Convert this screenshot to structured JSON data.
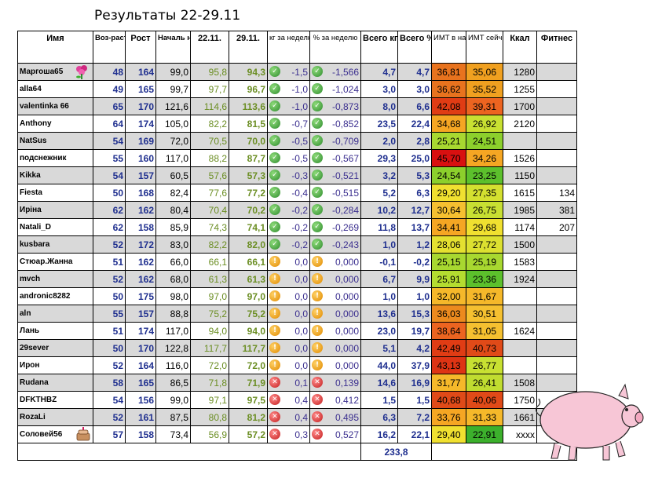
{
  "title": "Результаты  22-29.11",
  "headers": {
    "name": "Имя",
    "age": "Воз-раст",
    "height": "Рост",
    "start": "Началь ный вес",
    "w1": "22.11.",
    "w2": "29.11.",
    "dkg": "кг за неделю",
    "dpct": "% за неделю",
    "tkg": "Всего кг",
    "tpct": "Всего %",
    "bmi_start": "ИМТ в начале",
    "bmi_now": "ИМТ сейчас",
    "kcal": "Ккал",
    "fitness": "Фитнес"
  },
  "colors": {
    "ok": "#2e8b2e",
    "flat": "#e08a00",
    "bad": "#c41e1e",
    "shade": "#d9d9d9"
  },
  "rows": [
    {
      "name": "Маргоша65",
      "age": "48",
      "height": "164",
      "start": "99,0",
      "w1": "95,8",
      "w2": "94,3",
      "status": "ok",
      "dkg": "-1,5",
      "dpct": "-1,566",
      "tkg": "4,7",
      "tpct": "4,7",
      "b1": "36,81",
      "b1c": "#e8731e",
      "b2": "35,06",
      "b2c": "#f0a020",
      "kcal": "1280",
      "fit": "",
      "shade": true,
      "icon": "flower-icon"
    },
    {
      "name": "alla64",
      "age": "49",
      "height": "165",
      "start": "99,7",
      "w1": "97,7",
      "w2": "96,7",
      "status": "ok",
      "dkg": "-1,0",
      "dpct": "-1,024",
      "tkg": "3,0",
      "tpct": "3,0",
      "b1": "36,62",
      "b1c": "#e8731e",
      "b2": "35,52",
      "b2c": "#f0a020",
      "kcal": "1255",
      "fit": "",
      "shade": false
    },
    {
      "name": "valentinka 66",
      "age": "65",
      "height": "170",
      "start": "121,6",
      "w1": "114,6",
      "w2": "113,6",
      "status": "ok",
      "dkg": "-1,0",
      "dpct": "-0,873",
      "tkg": "8,0",
      "tpct": "6,6",
      "b1": "42,08",
      "b1c": "#e03c14",
      "b2": "39,31",
      "b2c": "#ec6420",
      "kcal": "1700",
      "fit": "",
      "shade": true
    },
    {
      "name": "Anthony",
      "age": "64",
      "height": "174",
      "start": "105,0",
      "w1": "82,2",
      "w2": "81,5",
      "status": "ok",
      "dkg": "-0,7",
      "dpct": "-0,852",
      "tkg": "23,5",
      "tpct": "22,4",
      "b1": "34,68",
      "b1c": "#f5a623",
      "b2": "26,92",
      "b2c": "#c8e032",
      "kcal": "2120",
      "fit": "",
      "shade": false
    },
    {
      "name": "NatSus",
      "age": "54",
      "height": "169",
      "start": "72,0",
      "w1": "70,5",
      "w2": "70,0",
      "status": "ok",
      "dkg": "-0,5",
      "dpct": "-0,709",
      "tkg": "2,0",
      "tpct": "2,8",
      "b1": "25,21",
      "b1c": "#a8d830",
      "b2": "24,51",
      "b2c": "#8cd02c",
      "kcal": "",
      "fit": "",
      "shade": true
    },
    {
      "name": "подснежник",
      "age": "55",
      "height": "160",
      "start": "117,0",
      "w1": "88,2",
      "w2": "87,7",
      "status": "ok",
      "dkg": "-0,5",
      "dpct": "-0,567",
      "tkg": "29,3",
      "tpct": "25,0",
      "b1": "45,70",
      "b1c": "#d81010",
      "b2": "34,26",
      "b2c": "#f5a623",
      "kcal": "1526",
      "fit": "",
      "shade": false
    },
    {
      "name": "Kikka",
      "age": "54",
      "height": "157",
      "start": "60,5",
      "w1": "57,6",
      "w2": "57,3",
      "status": "ok",
      "dkg": "-0,3",
      "dpct": "-0,521",
      "tkg": "3,2",
      "tpct": "5,3",
      "b1": "24,54",
      "b1c": "#8cd02c",
      "b2": "23,25",
      "b2c": "#5cc02c",
      "kcal": "1150",
      "fit": "",
      "shade": true
    },
    {
      "name": "Fiesta",
      "age": "50",
      "height": "168",
      "start": "82,4",
      "w1": "77,6",
      "w2": "77,2",
      "status": "ok",
      "dkg": "-0,4",
      "dpct": "-0,515",
      "tkg": "5,2",
      "tpct": "6,3",
      "b1": "29,20",
      "b1c": "#f0e030",
      "b2": "27,35",
      "b2c": "#d4e030",
      "kcal": "1615",
      "fit": "134",
      "shade": false
    },
    {
      "name": "Ирiна",
      "age": "62",
      "height": "162",
      "start": "80,4",
      "w1": "70,4",
      "w2": "70,2",
      "status": "ok",
      "dkg": "-0,2",
      "dpct": "-0,284",
      "tkg": "10,2",
      "tpct": "12,7",
      "b1": "30,64",
      "b1c": "#f5c030",
      "b2": "26,75",
      "b2c": "#c8e032",
      "kcal": "1985",
      "fit": "381",
      "shade": true
    },
    {
      "name": "Natali_D",
      "age": "62",
      "height": "158",
      "start": "85,9",
      "w1": "74,3",
      "w2": "74,1",
      "status": "ok",
      "dkg": "-0,2",
      "dpct": "-0,269",
      "tkg": "11,8",
      "tpct": "13,7",
      "b1": "34,41",
      "b1c": "#f5a623",
      "b2": "29,68",
      "b2c": "#f0e030",
      "kcal": "1174",
      "fit": "207",
      "shade": false
    },
    {
      "name": "kusbara",
      "age": "52",
      "height": "172",
      "start": "83,0",
      "w1": "82,2",
      "w2": "82,0",
      "status": "ok",
      "dkg": "-0,2",
      "dpct": "-0,243",
      "tkg": "1,0",
      "tpct": "1,2",
      "b1": "28,06",
      "b1c": "#e4e030",
      "b2": "27,72",
      "b2c": "#dce030",
      "kcal": "1500",
      "fit": "",
      "shade": true
    },
    {
      "name": "Стюар.Жанна",
      "age": "51",
      "height": "162",
      "start": "66,0",
      "w1": "66,1",
      "w2": "66,1",
      "status": "flat",
      "dkg": "0,0",
      "dpct": "0,000",
      "tkg": "-0,1",
      "tpct": "-0,2",
      "b1": "25,15",
      "b1c": "#a8d830",
      "b2": "25,19",
      "b2c": "#a8d830",
      "kcal": "1583",
      "fit": "",
      "shade": false
    },
    {
      "name": "mvch",
      "age": "52",
      "height": "162",
      "start": "68,0",
      "w1": "61,3",
      "w2": "61,3",
      "status": "flat",
      "dkg": "0,0",
      "dpct": "0,000",
      "tkg": "6,7",
      "tpct": "9,9",
      "b1": "25,91",
      "b1c": "#b4dc30",
      "b2": "23,36",
      "b2c": "#5cc02c",
      "kcal": "1924",
      "fit": "",
      "shade": true
    },
    {
      "name": "andronic8282",
      "age": "50",
      "height": "175",
      "start": "98,0",
      "w1": "97,0",
      "w2": "97,0",
      "status": "flat",
      "dkg": "0,0",
      "dpct": "0,000",
      "tkg": "1,0",
      "tpct": "1,0",
      "b1": "32,00",
      "b1c": "#f5b82a",
      "b2": "31,67",
      "b2c": "#f5b82a",
      "kcal": "",
      "fit": "",
      "shade": false
    },
    {
      "name": "aln",
      "age": "55",
      "height": "157",
      "start": "88,8",
      "w1": "75,2",
      "w2": "75,2",
      "status": "flat",
      "dkg": "0,0",
      "dpct": "0,000",
      "tkg": "13,6",
      "tpct": "15,3",
      "b1": "36,03",
      "b1c": "#ec8a1e",
      "b2": "30,51",
      "b2c": "#f5c030",
      "kcal": "",
      "fit": "",
      "shade": true
    },
    {
      "name": "Лань",
      "age": "51",
      "height": "174",
      "start": "117,0",
      "w1": "94,0",
      "w2": "94,0",
      "status": "flat",
      "dkg": "0,0",
      "dpct": "0,000",
      "tkg": "23,0",
      "tpct": "19,7",
      "b1": "38,64",
      "b1c": "#ec6420",
      "b2": "31,05",
      "b2c": "#f5c030",
      "kcal": "1624",
      "fit": "",
      "shade": false
    },
    {
      "name": "29sever",
      "age": "50",
      "height": "170",
      "start": "122,8",
      "w1": "117,7",
      "w2": "117,7",
      "status": "flat",
      "dkg": "0,0",
      "dpct": "0,000",
      "tkg": "5,1",
      "tpct": "4,2",
      "b1": "42,49",
      "b1c": "#e03c14",
      "b2": "40,73",
      "b2c": "#e04a18",
      "kcal": "",
      "fit": "",
      "shade": true
    },
    {
      "name": "Ирон",
      "age": "52",
      "height": "164",
      "start": "116,0",
      "w1": "72,0",
      "w2": "72,0",
      "status": "flat",
      "dkg": "0,0",
      "dpct": "0,000",
      "tkg": "44,0",
      "tpct": "37,9",
      "b1": "43,13",
      "b1c": "#de3414",
      "b2": "26,77",
      "b2c": "#c8e032",
      "kcal": "",
      "fit": "",
      "shade": false
    },
    {
      "name": "Rudana",
      "age": "58",
      "height": "165",
      "start": "86,5",
      "w1": "71,8",
      "w2": "71,9",
      "status": "bad",
      "dkg": "0,1",
      "dpct": "0,139",
      "tkg": "14,6",
      "tpct": "16,9",
      "b1": "31,77",
      "b1c": "#f5b82a",
      "b2": "26,41",
      "b2c": "#c0dc30",
      "kcal": "1508",
      "fit": "",
      "shade": true
    },
    {
      "name": "DFKTHBZ",
      "age": "54",
      "height": "156",
      "start": "99,0",
      "w1": "97,1",
      "w2": "97,5",
      "status": "bad",
      "dkg": "0,4",
      "dpct": "0,412",
      "tkg": "1,5",
      "tpct": "1,5",
      "b1": "40,68",
      "b1c": "#e04a18",
      "b2": "40,06",
      "b2c": "#e04a18",
      "kcal": "1750",
      "fit": "",
      "shade": false
    },
    {
      "name": "RozaLi",
      "age": "52",
      "height": "161",
      "start": "87,5",
      "w1": "80,8",
      "w2": "81,2",
      "status": "bad",
      "dkg": "0,4",
      "dpct": "0,495",
      "tkg": "6,3",
      "tpct": "7,2",
      "b1": "33,76",
      "b1c": "#f5a623",
      "b2": "31,33",
      "b2c": "#f5b82a",
      "kcal": "1661",
      "fit": "",
      "shade": true
    },
    {
      "name": "Соловей56",
      "age": "57",
      "height": "158",
      "start": "73,4",
      "w1": "56,9",
      "w2": "57,2",
      "status": "bad",
      "dkg": "0,3",
      "dpct": "0,527",
      "tkg": "16,2",
      "tpct": "22,1",
      "b1": "29,40",
      "b1c": "#f0e030",
      "b2": "22,91",
      "b2c": "#3cb02c",
      "kcal": "xxxx",
      "fit": "",
      "shade": false,
      "icon": "cake-icon"
    }
  ],
  "total_kg": "233,8"
}
